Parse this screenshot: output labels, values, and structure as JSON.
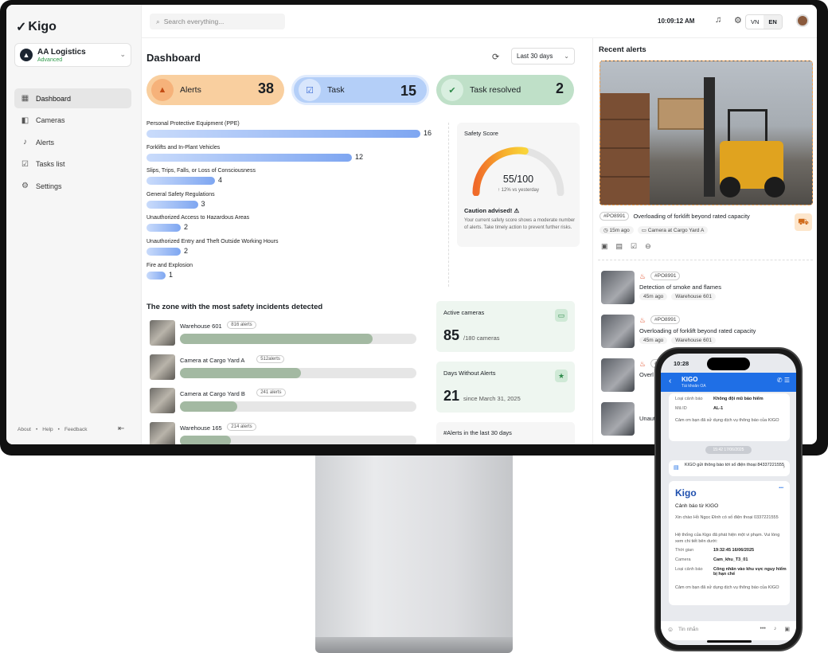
{
  "sidebar": {
    "logo": "Kigo",
    "org": {
      "name": "AA Logistics",
      "tier": "Advanced"
    },
    "items": [
      {
        "label": "Dashboard",
        "icon": "grid-icon",
        "active": true
      },
      {
        "label": "Cameras",
        "icon": "camera-icon"
      },
      {
        "label": "Alerts",
        "icon": "bell-icon"
      },
      {
        "label": "Tasks list",
        "icon": "clipboard-icon"
      },
      {
        "label": "Settings",
        "icon": "gear-icon"
      }
    ],
    "footer": {
      "about": "About",
      "help": "Help",
      "feedback": "Feedback"
    }
  },
  "header": {
    "search_placeholder": "Search everything...",
    "time": "10:09:12 AM",
    "lang": [
      "VN",
      "EN"
    ],
    "lang_selected": "EN"
  },
  "dashboard": {
    "title": "Dashboard",
    "range": "Last 30 days",
    "stats": [
      {
        "label": "Alerts",
        "value": "38",
        "color": "#f9cf9f"
      },
      {
        "label": "Task",
        "value": "15",
        "color": "#b4cff8"
      },
      {
        "label": "Task resolved",
        "value": "2",
        "color": "#bfe0c8"
      }
    ],
    "chart_data": {
      "type": "bar",
      "orientation": "horizontal",
      "categories": [
        "Personal Protective Equipment (PPE)",
        "Forklifts and In-Plant Vehicles",
        "Slips, Trips, Falls, or Loss of Consciousness",
        "General Safety Regulations",
        "Unauthorized Access to Hazardous Areas",
        "Unauthorized Entry and Theft Outside Working Hours",
        "Fire and Explosion"
      ],
      "values": [
        16,
        12,
        4,
        3,
        2,
        2,
        1
      ]
    },
    "safety_score": {
      "title": "Safety Score",
      "value": "55/100",
      "score": 55,
      "max": 100,
      "change": "↑ 12% vs yesterday",
      "caution": "Caution advised! ⚠",
      "description": "Your current safety score shows a moderate number of alerts. Take timely action to prevent further risks."
    },
    "zones": {
      "title": "The zone with the most safety incidents detected",
      "items": [
        {
          "name": "Warehouse 601",
          "badge": "816 alerts",
          "value": 816
        },
        {
          "name": "Camera at Cargo Yard A",
          "badge": "512alerts",
          "value": 512
        },
        {
          "name": "Camera at Cargo Yard B",
          "badge": "241 alerts",
          "value": 241
        },
        {
          "name": "Warehouse 165",
          "badge": "214 alerts",
          "value": 214
        }
      ],
      "max": 1000
    },
    "active_cameras": {
      "label": "Active cameras",
      "value": "85",
      "unit": "/180 cameras"
    },
    "days_without": {
      "label": "Days Without Alerts",
      "value": "21",
      "unit": "since March 31, 2025"
    },
    "alerts_hist": {
      "label": "#Alerts in the last 30 days"
    }
  },
  "recent": {
    "title": "Recent alerts",
    "featured": {
      "id": "#PO8991",
      "title": "Overloading of forklift beyond rated capacity",
      "time": "15m ago",
      "camera": "Camera at Cargo Yard A"
    },
    "items": [
      {
        "id": "#PO8991",
        "title": "Detection of smoke and flames",
        "time": "45m ago",
        "camera": "Warehouse 601"
      },
      {
        "id": "#PO8991",
        "title": "Overloading of forklift beyond rated capacity",
        "time": "45m ago",
        "camera": "Warehouse 601"
      },
      {
        "id": "#PO8991",
        "title": "Overl",
        "time": "",
        "camera": ""
      },
      {
        "id": "",
        "title": "Unaut",
        "time": "",
        "camera": ""
      }
    ]
  },
  "phone": {
    "time": "10:28",
    "chat_name": "KIGO",
    "chat_sub": "Tài khoản OA",
    "msg1": [
      {
        "k": "Loại cảnh báo",
        "v": "Không đội mũ bảo hiểm"
      },
      {
        "k": "Mã ID",
        "v": "AL-1"
      }
    ],
    "msg1_footer": "Cảm ơn bạn đã sử dụng dịch vụ thông báo của KIGO",
    "timestamp": "15:42 17/06/2025",
    "notice": "KIGO gửi thông báo tới số điện thoại 84337221555",
    "card_logo": "Kigo",
    "card_title": "Cảnh báo từ KIGO",
    "greeting": "Xin chào Hồ Ngọc Đình có số điện thoại 0337221555",
    "body": "Hệ thống của Kigo đã phát hiện một vi phạm. Vui lòng xem chi tiết bên dưới:",
    "fields": [
      {
        "k": "Thời gian",
        "v": "19:32:45 16/06/2025"
      },
      {
        "k": "Camera",
        "v": "Cam_khu_T3_01"
      },
      {
        "k": "Loại cảnh báo",
        "v": "Công nhân vào khu vực nguy hiểm bị hạn chế"
      }
    ],
    "footer": "Cảm ơn bạn đã sử dụng dịch vụ thông báo của KIGO",
    "input_placeholder": "Tin nhắn"
  }
}
